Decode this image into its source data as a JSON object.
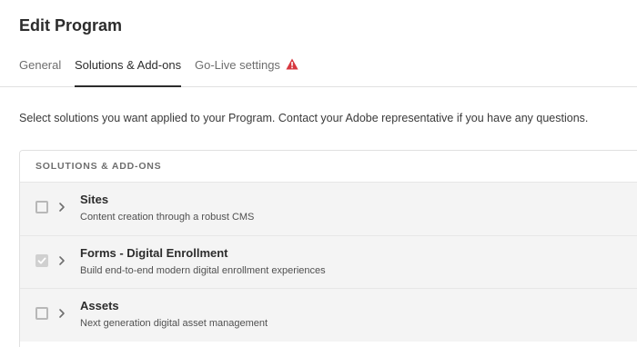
{
  "page": {
    "title": "Edit Program"
  },
  "tabs": [
    {
      "label": "General",
      "active": false
    },
    {
      "label": "Solutions & Add-ons",
      "active": true
    },
    {
      "label": "Go-Live settings",
      "active": false,
      "icon": "warning-icon"
    }
  ],
  "description": "Select solutions you want applied to your Program. Contact your Adobe representative if you have any questions.",
  "table": {
    "header": "SOLUTIONS & ADD-ONS",
    "rows": [
      {
        "title": "Sites",
        "subtitle": "Content creation through a robust CMS",
        "checked": false,
        "disabled": false
      },
      {
        "title": "Forms - Digital Enrollment",
        "subtitle": "Build end-to-end modern digital enrollment experiences",
        "checked": true,
        "disabled": true
      },
      {
        "title": "Assets",
        "subtitle": "Next generation digital asset management",
        "checked": false,
        "disabled": false
      }
    ]
  },
  "colors": {
    "warning": "#d7373f",
    "active_underline": "#2c2c2c",
    "row_background": "#f4f4f4"
  }
}
